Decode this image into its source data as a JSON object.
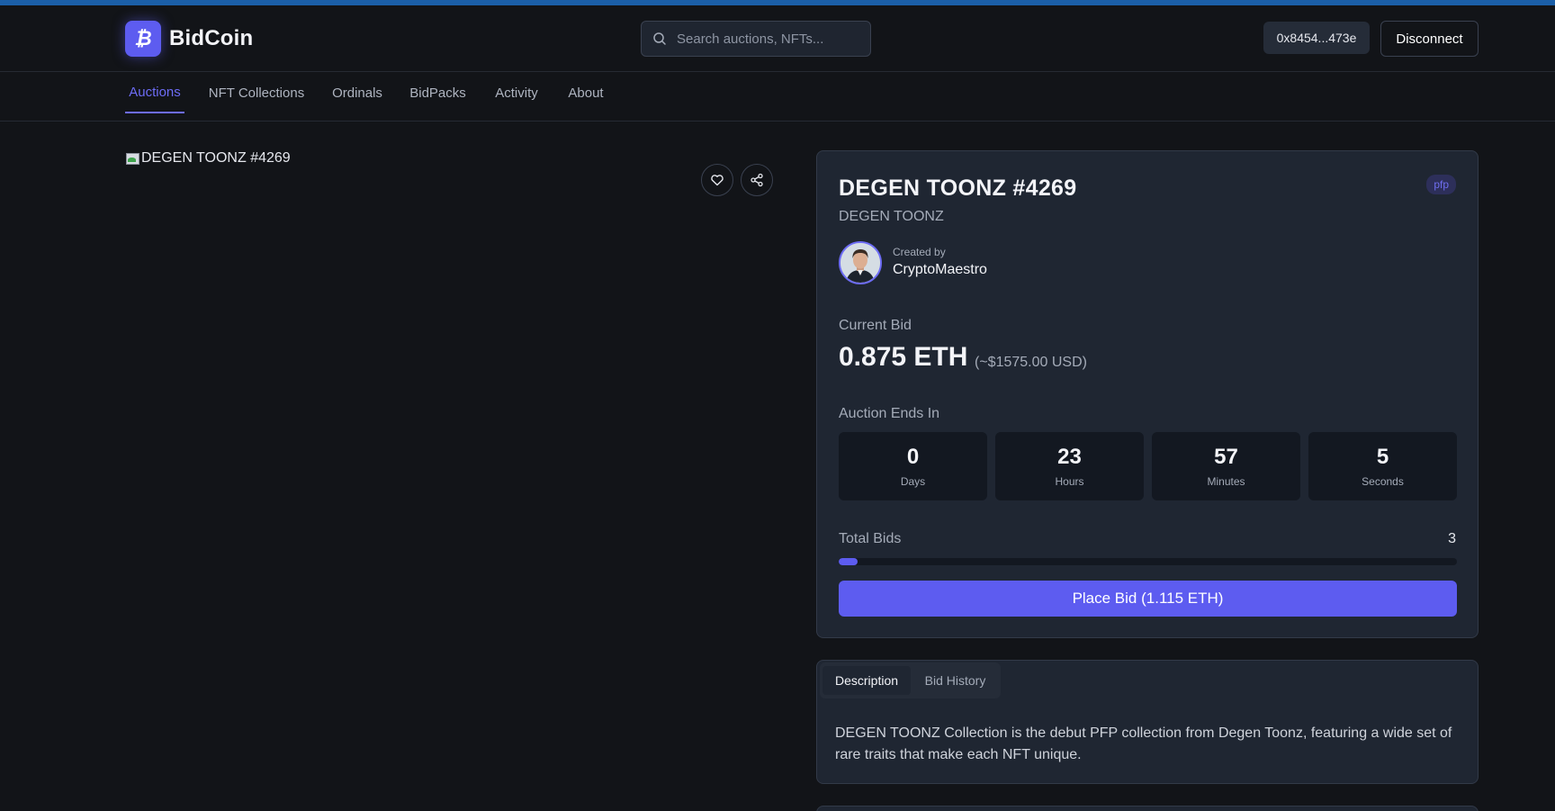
{
  "app": {
    "name": "BidCoin",
    "logo_glyph": "₿",
    "accent_color": "#5d5cf0"
  },
  "header": {
    "search_placeholder": "Search auctions, NFTs...",
    "wallet_address": "0x8454...473e",
    "disconnect_label": "Disconnect"
  },
  "nav": {
    "items": [
      {
        "label": "Auctions",
        "active": true
      },
      {
        "label": "NFT Collections",
        "active": false
      },
      {
        "label": "Ordinals",
        "active": false
      },
      {
        "label": "BidPacks",
        "active": false
      },
      {
        "label": "Activity",
        "active": false
      },
      {
        "label": "About",
        "active": false
      }
    ]
  },
  "item": {
    "image_alt": "DEGEN TOONZ #4269",
    "title": "DEGEN TOONZ #4269",
    "collection": "DEGEN TOONZ",
    "category_badge": "pfp",
    "created_by_label": "Created by",
    "creator": "CryptoMaestro"
  },
  "bid": {
    "current_bid_label": "Current Bid",
    "amount": "0.875 ETH",
    "usd": "(~$1575.00 USD)",
    "ends_label": "Auction Ends In",
    "countdown": [
      {
        "value": "0",
        "unit": "Days"
      },
      {
        "value": "23",
        "unit": "Hours"
      },
      {
        "value": "57",
        "unit": "Minutes"
      },
      {
        "value": "5",
        "unit": "Seconds"
      }
    ],
    "total_bids_label": "Total Bids",
    "total_bids": "3",
    "bids_progress_fraction": 0.03,
    "place_bid_label": "Place Bid (1.115 ETH)"
  },
  "details": {
    "tabs": [
      {
        "label": "Description",
        "active": true
      },
      {
        "label": "Bid History",
        "active": false
      }
    ],
    "description": "DEGEN TOONZ Collection is the debut PFP collection from Degen Toonz, featuring a wide set of rare traits that make each NFT unique."
  },
  "icons": {
    "search": "search-icon",
    "favorite": "heart-icon",
    "share": "share-icon"
  }
}
